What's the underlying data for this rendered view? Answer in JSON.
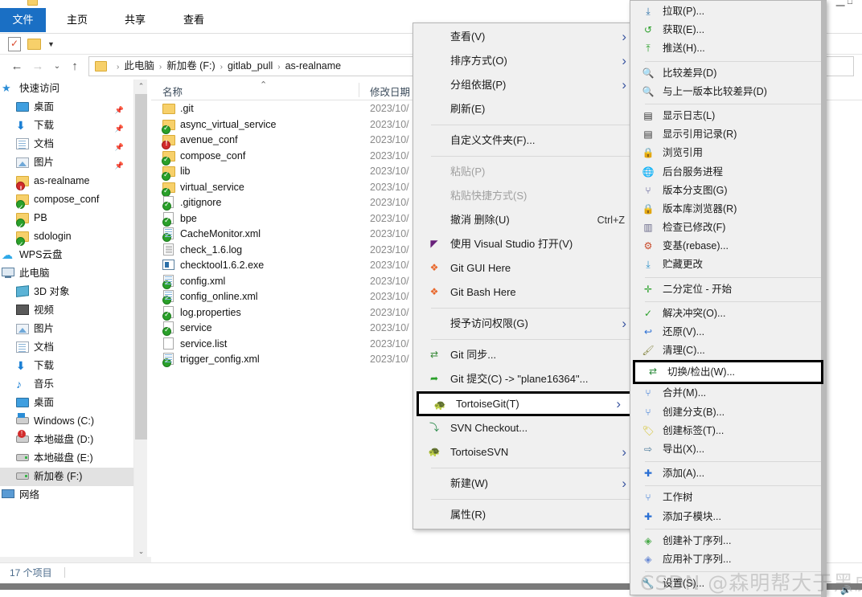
{
  "window": {
    "ribbon_tabs": [
      {
        "label": "文件",
        "active": true
      },
      {
        "label": "主页",
        "active": false
      },
      {
        "label": "共享",
        "active": false
      },
      {
        "label": "查看",
        "active": false
      }
    ],
    "nav": {
      "back": "←",
      "forward": "→",
      "recent": "⌄",
      "up": "↑"
    },
    "breadcrumb": [
      "此电脑",
      "新加卷 (F:)",
      "gitlab_pull",
      "as-realname"
    ],
    "breadcrumb_separator": "›",
    "status": "17 个项目"
  },
  "sidebar": {
    "items": [
      {
        "label": "快速访问",
        "icon": "star-icon",
        "indent": 20,
        "pinned": false
      },
      {
        "label": "桌面",
        "icon": "desktop-icon",
        "indent": 38,
        "pinned": true
      },
      {
        "label": "下载",
        "icon": "download-icon",
        "indent": 38,
        "pinned": true
      },
      {
        "label": "文档",
        "icon": "document-icon",
        "indent": 38,
        "pinned": true
      },
      {
        "label": "图片",
        "icon": "picture-icon",
        "indent": 38,
        "pinned": true
      },
      {
        "label": "as-realname",
        "icon": "folder-red-icon",
        "indent": 38,
        "pinned": false
      },
      {
        "label": "compose_conf",
        "icon": "folder-green-icon",
        "indent": 38,
        "pinned": false
      },
      {
        "label": "PB",
        "icon": "folder-green-icon",
        "indent": 38,
        "pinned": false
      },
      {
        "label": "sdologin",
        "icon": "folder-green-icon",
        "indent": 38,
        "pinned": false
      },
      {
        "label": "WPS云盘",
        "icon": "cloud-icon",
        "indent": 20,
        "pinned": false
      },
      {
        "label": "此电脑",
        "icon": "computer-icon",
        "indent": 20,
        "pinned": false
      },
      {
        "label": "3D 对象",
        "icon": "object3d-icon",
        "indent": 38,
        "pinned": false
      },
      {
        "label": "视频",
        "icon": "video-icon",
        "indent": 38,
        "pinned": false
      },
      {
        "label": "图片",
        "icon": "picture-icon",
        "indent": 38,
        "pinned": false
      },
      {
        "label": "文档",
        "icon": "document-icon",
        "indent": 38,
        "pinned": false
      },
      {
        "label": "下载",
        "icon": "download-icon",
        "indent": 38,
        "pinned": false
      },
      {
        "label": "音乐",
        "icon": "music-icon",
        "indent": 38,
        "pinned": false
      },
      {
        "label": "桌面",
        "icon": "desktop-icon",
        "indent": 38,
        "pinned": false
      },
      {
        "label": "Windows (C:)",
        "icon": "windows-drive-icon",
        "indent": 38,
        "pinned": false
      },
      {
        "label": "本地磁盘 (D:)",
        "icon": "drive-warning-icon",
        "indent": 38,
        "pinned": false
      },
      {
        "label": "本地磁盘 (E:)",
        "icon": "drive-icon",
        "indent": 38,
        "pinned": false
      },
      {
        "label": "新加卷 (F:)",
        "icon": "drive-icon",
        "indent": 38,
        "pinned": false,
        "selected": true
      },
      {
        "label": "网络",
        "icon": "network-icon",
        "indent": 20,
        "pinned": false
      }
    ],
    "scroll_up": "⌃",
    "scroll_down": "⌄"
  },
  "filelist": {
    "columns": [
      {
        "label": "名称",
        "key": "name"
      },
      {
        "label": "修改日期",
        "key": "date"
      }
    ],
    "sort_indicator": "⌃",
    "rows": [
      {
        "name": ".git",
        "date": "2023/10/",
        "icon": "folder-plain-icon"
      },
      {
        "name": "async_virtual_service",
        "date": "2023/10/",
        "icon": "folder-green-icon"
      },
      {
        "name": "avenue_conf",
        "date": "2023/10/",
        "icon": "folder-red-icon"
      },
      {
        "name": "compose_conf",
        "date": "2023/10/",
        "icon": "folder-green-icon"
      },
      {
        "name": "lib",
        "date": "2023/10/",
        "icon": "folder-green-icon"
      },
      {
        "name": "virtual_service",
        "date": "2023/10/",
        "icon": "folder-green-icon"
      },
      {
        "name": ".gitignore",
        "date": "2023/10/",
        "icon": "file-green-icon"
      },
      {
        "name": "bpe",
        "date": "2023/10/",
        "icon": "file-green-icon"
      },
      {
        "name": "CacheMonitor.xml",
        "date": "2023/10/",
        "icon": "xml-green-icon"
      },
      {
        "name": "check_1.6.log",
        "date": "2023/10/",
        "icon": "log-file-icon"
      },
      {
        "name": "checktool1.6.2.exe",
        "date": "2023/10/",
        "icon": "exe-icon"
      },
      {
        "name": "config.xml",
        "date": "2023/10/",
        "icon": "xml-green-icon"
      },
      {
        "name": "config_online.xml",
        "date": "2023/10/",
        "icon": "xml-green-icon"
      },
      {
        "name": "log.properties",
        "date": "2023/10/",
        "icon": "file-green-icon"
      },
      {
        "name": "service",
        "date": "2023/10/",
        "icon": "file-green-icon"
      },
      {
        "name": "service.list",
        "date": "2023/10/",
        "icon": "plain-file-icon"
      },
      {
        "name": "trigger_config.xml",
        "date": "2023/10/",
        "icon": "xml-green-icon"
      }
    ]
  },
  "context_menu": {
    "items": [
      {
        "label": "查看(V)",
        "icon": null,
        "arrow": true
      },
      {
        "label": "排序方式(O)",
        "icon": null,
        "arrow": true
      },
      {
        "label": "分组依据(P)",
        "icon": null,
        "arrow": true
      },
      {
        "label": "刷新(E)",
        "icon": null,
        "arrow": false
      },
      {
        "separator": true
      },
      {
        "label": "自定义文件夹(F)...",
        "icon": null,
        "arrow": false
      },
      {
        "separator": true
      },
      {
        "label": "粘贴(P)",
        "icon": null,
        "arrow": false,
        "disabled": true
      },
      {
        "label": "粘贴快捷方式(S)",
        "icon": null,
        "arrow": false,
        "disabled": true
      },
      {
        "label": "撤消 删除(U)",
        "icon": null,
        "arrow": false,
        "accel": "Ctrl+Z"
      },
      {
        "label": "使用 Visual Studio 打开(V)",
        "icon": "visual-studio-icon",
        "arrow": false
      },
      {
        "label": "Git GUI Here",
        "icon": "git-icon",
        "arrow": false
      },
      {
        "label": "Git Bash Here",
        "icon": "git-icon",
        "arrow": false
      },
      {
        "separator": true
      },
      {
        "label": "授予访问权限(G)",
        "icon": null,
        "arrow": true
      },
      {
        "separator": true
      },
      {
        "label": "Git 同步...",
        "icon": "git-sync-icon",
        "arrow": false
      },
      {
        "label": "Git 提交(C) -> \"plane16364\"...",
        "icon": "git-commit-icon",
        "arrow": false
      },
      {
        "label": "TortoiseGit(T)",
        "icon": "tortoisegit-icon",
        "arrow": true,
        "highlighted": true
      },
      {
        "label": "SVN Checkout...",
        "icon": "svn-checkout-icon",
        "arrow": false
      },
      {
        "label": "TortoiseSVN",
        "icon": "tortoisesvn-icon",
        "arrow": true
      },
      {
        "separator": true
      },
      {
        "label": "新建(W)",
        "icon": null,
        "arrow": true
      },
      {
        "separator": true
      },
      {
        "label": "属性(R)",
        "icon": null,
        "arrow": false
      }
    ]
  },
  "submenu": {
    "items": [
      {
        "label": "拉取(P)...",
        "icon": "pull-icon"
      },
      {
        "label": "获取(E)...",
        "icon": "fetch-icon"
      },
      {
        "label": "推送(H)...",
        "icon": "push-icon"
      },
      {
        "separator": true
      },
      {
        "label": "比较差异(D)",
        "icon": "diff-icon"
      },
      {
        "label": "与上一版本比较差异(D)",
        "icon": "diff-prev-icon"
      },
      {
        "separator": true
      },
      {
        "label": "显示日志(L)",
        "icon": "log-icon"
      },
      {
        "label": "显示引用记录(R)",
        "icon": "reflog-icon"
      },
      {
        "label": "浏览引用",
        "icon": "browse-refs-icon"
      },
      {
        "label": "后台服务进程",
        "icon": "daemon-icon"
      },
      {
        "label": "版本分支图(G)",
        "icon": "revision-graph-icon"
      },
      {
        "label": "版本库浏览器(R)",
        "icon": "repo-browser-icon"
      },
      {
        "label": "检查已修改(F)",
        "icon": "check-modifications-icon"
      },
      {
        "label": "变基(rebase)...",
        "icon": "rebase-icon"
      },
      {
        "label": "贮藏更改",
        "icon": "stash-icon"
      },
      {
        "separator": true
      },
      {
        "label": "二分定位 - 开始",
        "icon": "bisect-icon"
      },
      {
        "separator": true
      },
      {
        "label": "解决冲突(O)...",
        "icon": "resolve-icon"
      },
      {
        "label": "还原(V)...",
        "icon": "revert-icon"
      },
      {
        "label": "清理(C)...",
        "icon": "cleanup-icon"
      },
      {
        "label": "切换/检出(W)...",
        "icon": "switch-checkout-icon",
        "highlighted": true
      },
      {
        "label": "合并(M)...",
        "icon": "merge-icon"
      },
      {
        "label": "创建分支(B)...",
        "icon": "create-branch-icon"
      },
      {
        "label": "创建标签(T)...",
        "icon": "create-tag-icon"
      },
      {
        "label": "导出(X)...",
        "icon": "export-icon"
      },
      {
        "separator": true
      },
      {
        "label": "添加(A)...",
        "icon": "add-icon"
      },
      {
        "separator": true
      },
      {
        "label": "工作树",
        "icon": "worktree-icon"
      },
      {
        "label": "添加子模块...",
        "icon": "add-submodule-icon"
      },
      {
        "separator": true
      },
      {
        "label": "创建补丁序列...",
        "icon": "create-patch-icon"
      },
      {
        "label": "应用补丁序列...",
        "icon": "apply-patch-icon"
      },
      {
        "separator": true
      },
      {
        "label": "设置(S)...",
        "icon": "settings-icon"
      }
    ]
  },
  "watermark": "CSDN @森明帮大于黑虎帮"
}
